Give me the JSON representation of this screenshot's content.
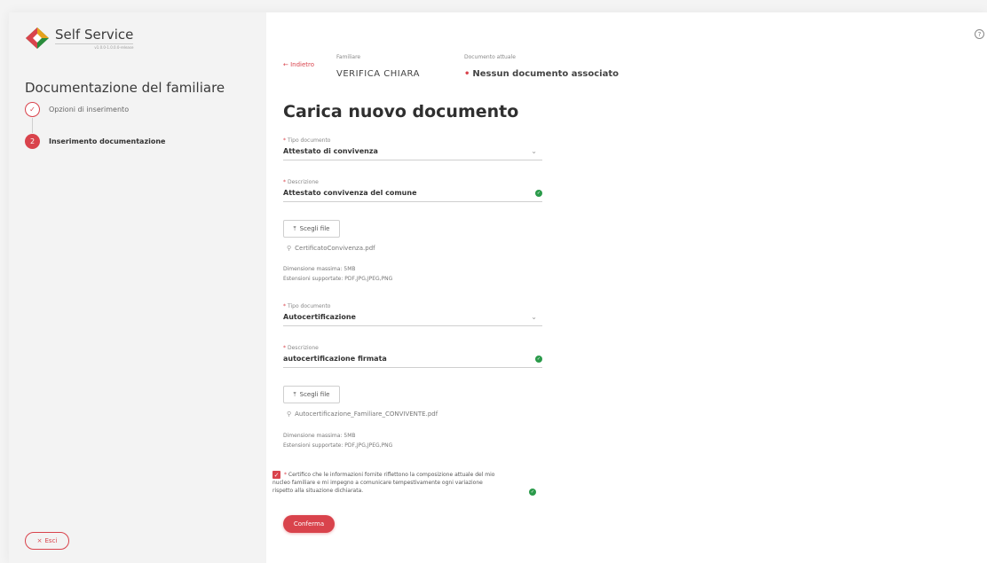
{
  "app": {
    "name": "Self Service",
    "version": "v1.0.0-1.0.0.0-release",
    "accent_color": "#d9434c",
    "success_color": "#2a9a4a"
  },
  "sidebar": {
    "title": "Documentazione del familiare",
    "steps": [
      {
        "number": "✓",
        "label": "Opzioni di inserimento",
        "state": "done"
      },
      {
        "number": "2",
        "label": "Inserimento documentazione",
        "state": "active"
      }
    ],
    "exit_icon": "×",
    "exit_label": "Esci"
  },
  "header": {
    "back_label": "← Indietro",
    "familiare_label": "Familiare",
    "familiare_value": "VERIFICA CHIARA",
    "documento_label": "Documento attuale",
    "documento_value": "Nessun documento associato"
  },
  "main": {
    "title": "Carica nuovo documento",
    "documents": [
      {
        "tipo_label": "Tipo documento",
        "tipo_value": "Attestato di convivenza",
        "descr_label": "Descrizione",
        "descr_value": "Attestato convivenza del comune",
        "file_button": "Scegli file",
        "file_name": "CertificatoConvivenza.pdf",
        "max_size": "Dimensione massima: 5MB",
        "extensions": "Estensioni supportate: PDF,JPG,JPEG,PNG"
      },
      {
        "tipo_label": "Tipo documento",
        "tipo_value": "Autocertificazione",
        "descr_label": "Descrizione",
        "descr_value": "autocertificazione firmata",
        "file_button": "Scegli file",
        "file_name": "Autocertificazione_Familiare_CONVIVENTE.pdf",
        "max_size": "Dimensione massima: 5MB",
        "extensions": "Estensioni supportate: PDF,JPG,JPEG,PNG"
      }
    ],
    "certification": {
      "checked": true,
      "text": "Certifico che le informazioni fornite riflettono la composizione attuale del mio nucleo familiare e mi impegno a comunicare tempestivamente ogni variazione rispetto alla situazione dichiarata."
    },
    "confirm_label": "Conferma"
  },
  "help_icon": "?"
}
